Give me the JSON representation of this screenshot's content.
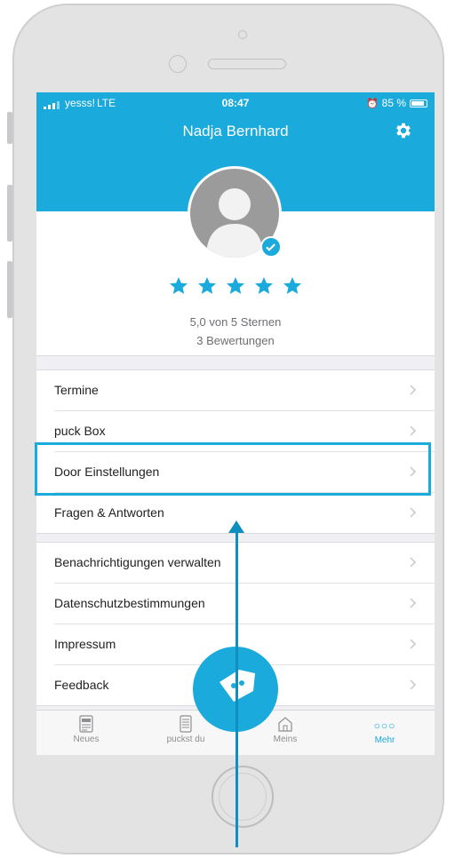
{
  "statusbar": {
    "carrier": "yesss!",
    "network": "LTE",
    "time": "08:47",
    "battery": "85 %"
  },
  "header": {
    "title": "Nadja Bernhard"
  },
  "profile": {
    "stars": 5,
    "rating_text": "5,0 von 5 Sternen",
    "reviews_text": "3 Bewertungen"
  },
  "menu_group1": [
    "Termine",
    "puck Box",
    "Door Einstellungen",
    "Fragen & Antworten"
  ],
  "menu_group2": [
    "Benachrichtigungen verwalten",
    "Datenschutzbestimmungen",
    "Impressum",
    "Feedback"
  ],
  "tabs": [
    {
      "label": "Neues",
      "icon": "newspaper-icon"
    },
    {
      "label": "puckst du",
      "icon": "box-icon"
    },
    {
      "label": "Meins",
      "icon": "home-icon"
    },
    {
      "label": "Mehr",
      "icon": "more-dots-icon",
      "active": true
    }
  ],
  "colors": {
    "accent": "#1aaadc",
    "background": "#efeff4"
  }
}
